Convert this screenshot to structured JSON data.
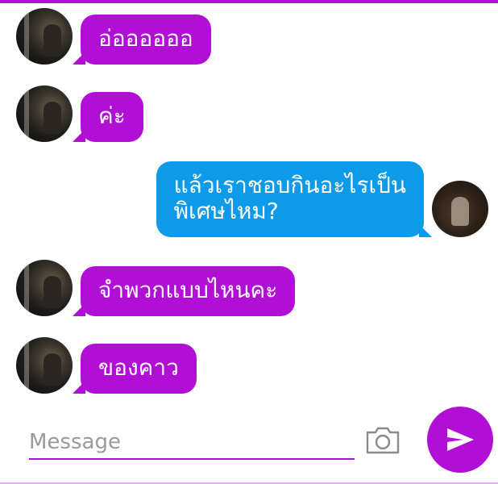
{
  "colors": {
    "received_bubble": "#b10fd6",
    "sent_bubble": "#0d9ae8",
    "accent": "#b10fd6",
    "bubble_text": "#ffffff"
  },
  "messages": [
    {
      "direction": "received",
      "text": "อ่ออออออ",
      "avatar": "avatar-image"
    },
    {
      "direction": "received",
      "text": "ค่ะ",
      "avatar": "avatar-image"
    },
    {
      "direction": "sent",
      "text_lines": [
        "แล้วเราชอบกินอะไรเป็น",
        "พิเศษไหม?"
      ],
      "avatar": "avatar-image"
    },
    {
      "direction": "received",
      "text": "จำพวกแบบไหนคะ",
      "avatar": "avatar-image"
    },
    {
      "direction": "received",
      "text": "ของคาว",
      "avatar": "avatar-image"
    }
  ],
  "composer": {
    "placeholder": "Message",
    "camera_icon": "camera-icon",
    "send_icon": "send-icon"
  }
}
